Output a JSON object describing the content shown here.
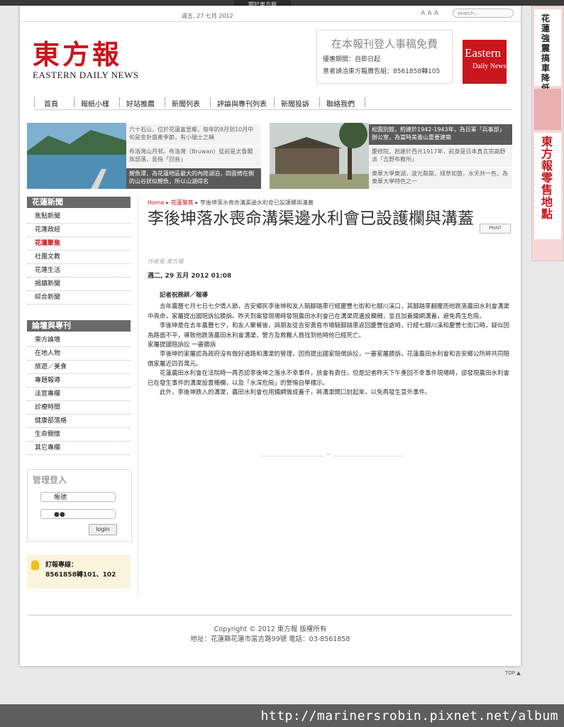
{
  "topbar": {
    "tab": "關於東方報"
  },
  "header": {
    "date": "週五, 27 七月 2012",
    "search_placeholder": "search...",
    "logo_cn": "東方報",
    "logo_en": "EASTERN DAILY NEWS",
    "ad_title": "在本報刊登人事稿免費",
    "ad_line1": "優惠期間：自即日起",
    "ad_line2": "意者請洽東方報廣告組：8561858轉105",
    "badge_line1": "Eastern",
    "badge_line2": "Daily News"
  },
  "nav": [
    "首頁",
    "報紙小樣",
    "好站推薦",
    "新聞列表",
    "評論與專刊列表",
    "新聞投訴",
    "聯絡我們"
  ],
  "features": {
    "left": [
      "六十石山，位於花蓮富里鄉，每年的8月到10月中旬是金針盛產季節，有小瑞士之稱",
      "布洛灣山月邨。布洛灣（Bruwan）從前是太魯閣族部落，意指「回音」",
      "鯉魚潭，為花蓮地區最大的內陸湖泊，四面倚在側的山谷狀似鯉魚，所以山湖得名"
    ],
    "right": [
      "松園別館，約建於1942-1943年，為日軍「兵事部」辦公室，為當時美崙山重要建築",
      "慶修院，創建於西元1917年，前身是日本真言宗高野派「吉野布教所」",
      "東華大學東湖，波光粼粼，綠草如茵，水天共一色，為東華大學特色之一"
    ]
  },
  "sidebar": {
    "news_header": "花蓮新聞",
    "news_items": [
      "焦點新聞",
      "花蓮政經",
      "花蓮聚焦",
      "社團文教",
      "花蓮生活",
      "揭鎮新聞",
      "綜合新聞"
    ],
    "forum_header": "論壇與專刊",
    "forum_items": [
      "東方論壇",
      "在地人物",
      "旅遊／美食",
      "專題報導",
      "法官專欄",
      "診療時間",
      "健康部落格",
      "生命關懷",
      "其它專欄"
    ],
    "login_header": "管理登入",
    "user_placeholder": "帳號",
    "pass_value": "●●",
    "login_button": "login",
    "hotline_label": "訂報專線：",
    "hotline_value": "8561858轉101、102"
  },
  "article": {
    "crumb_home": "Home",
    "crumb_cat": "花蓮聚焦",
    "crumb_title": "李後坤落水喪命溝渠邊水利會已設護欄與溝蓋",
    "title": "李後坤落水喪命溝渠邊水利會已設護欄與溝蓋",
    "print": "PRINT",
    "author": "作者是 東方報",
    "date": "週二, 29 五月 2012 01:08",
    "reporter": "記者祝務耕／報導",
    "p1": "去年農曆七月七日七夕情人節，吉安鄉民李後坤和友人騎腳踏車行經慶豐七街和七腳川溪口，其腳踏車翻覆而他跌落農田水利會溝渠中喪命，家屬提出國賠訴訟勝訴。昨天到案發現場時發現農田水利會已在溝渠周邊設欄柵，並且加蓋鐵網溝蓋，避免再生危險。",
    "p2": "李後坤是在去年農曆七夕，和友人聚餐後，與朋友從吉安黃昏市場騎腳踏車返回慶豐住處時，行經七腳川溪和慶豐七街口時，疑似因為路面不平，導致他跌落農田水利會溝渠，警方及救難人員找到他時他已經死亡。",
    "p3": "家屬提國賠訴訟 一審勝訴",
    "p4": "李後坤的家屬認為政府沒有做好道路和溝渠的管理，因而提出國家賠償訴訟，一審家屬勝訴，花蓮農田水利會和吉安鄉公所將共同賠償家屬近四百萬元。",
    "p5": "花蓮農田水利會在法院時一再否認李後坤之落水不幸事件，該會有責任。但是記者昨天下午重回不幸事件現場時，卻發現農田水利會已在發生事件的溝渠設置柵欄，以及「水深危險」的警惕自學標示。",
    "p6": "此外，李後坤跌入的溝渠，農田水利會也用鐵網做成蓋子，將溝渠開口封起來，以免再發生意外事件。"
  },
  "footer": {
    "copyright": "Copyright © 2012 東方報 版權所有",
    "address": "地址：花蓮縣花蓮市富吉路99號 電話：03-8561858",
    "top": "TOP ▲"
  },
  "right_ad": {
    "text1": "花蓮強震搞車降低",
    "text2": "東方報 零售地點"
  },
  "watermark": "http://marinersrobin.pixnet.net/album"
}
